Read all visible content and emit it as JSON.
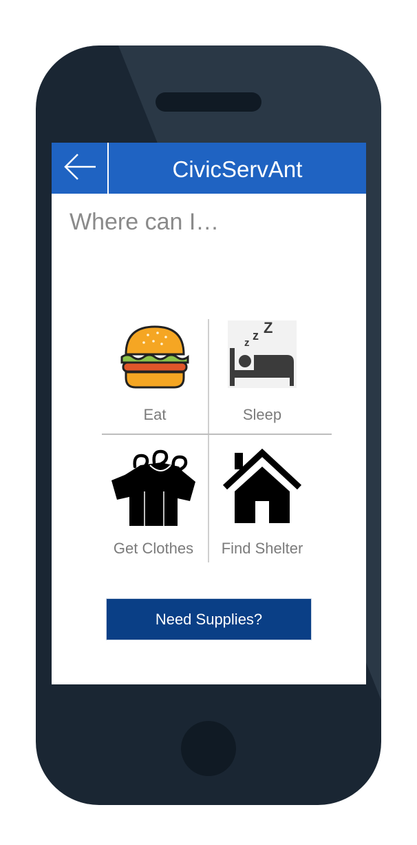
{
  "header": {
    "back_icon": "arrow-left-icon",
    "title": "CivicServAnt"
  },
  "prompt": "Where can I…",
  "services": [
    {
      "label": "Eat",
      "icon": "burger-icon"
    },
    {
      "label": "Sleep",
      "icon": "bed-icon"
    },
    {
      "label": "Get Clothes",
      "icon": "shirts-icon"
    },
    {
      "label": "Find Shelter",
      "icon": "house-icon"
    }
  ],
  "supplies_button": {
    "label": "Need Supplies?"
  },
  "colors": {
    "appbar": "#1f63c2",
    "button": "#0a3f86",
    "phone_body": "#1a2633"
  }
}
